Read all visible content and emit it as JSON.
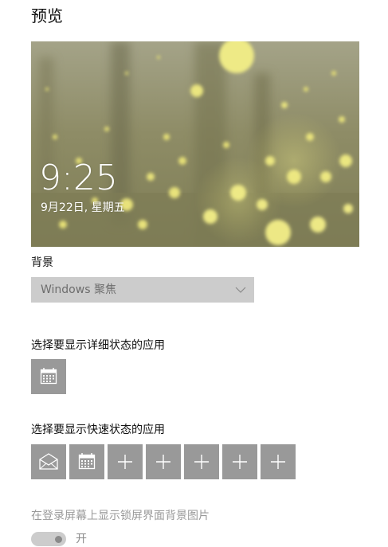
{
  "page": {
    "title": "预览"
  },
  "preview": {
    "time": "9:25",
    "date": "9月22日, 星期五"
  },
  "background": {
    "label": "背景",
    "selected": "Windows 聚焦"
  },
  "detailed_status": {
    "label": "选择要显示详细状态的应用",
    "apps": [
      {
        "icon": "calendar-icon"
      }
    ]
  },
  "quick_status": {
    "label": "选择要显示快速状态的应用",
    "apps": [
      {
        "icon": "mail-icon"
      },
      {
        "icon": "calendar-icon"
      },
      {
        "icon": "plus-icon"
      },
      {
        "icon": "plus-icon"
      },
      {
        "icon": "plus-icon"
      },
      {
        "icon": "plus-icon"
      },
      {
        "icon": "plus-icon"
      }
    ]
  },
  "signin_background": {
    "label": "在登录屏幕上显示锁屏界面背景图片",
    "state": "开",
    "on": true
  },
  "colors": {
    "tile": "#999999",
    "dropdown": "#cccccc",
    "toggle_track": "#cccccc"
  }
}
